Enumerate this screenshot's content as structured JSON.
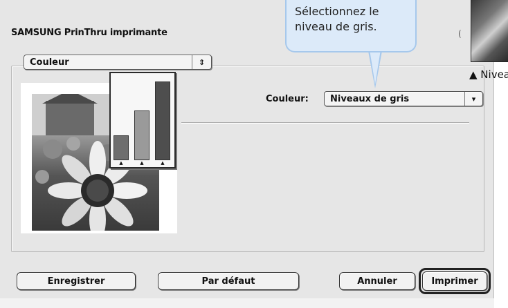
{
  "dialog": {
    "title": "SAMSUNG PrinThru imprimante",
    "title_right_mark": "("
  },
  "section_popup": {
    "value": "Couleur",
    "arrow": "⇕"
  },
  "color_setting": {
    "label": "Couleur:",
    "value": "Niveaux de gris",
    "arrow": "▾"
  },
  "preview": {
    "bars": [
      {
        "name": "low",
        "value": 0.3,
        "color": "#6e6e6e"
      },
      {
        "name": "mid",
        "value": 0.6,
        "color": "#9a9a9a"
      },
      {
        "name": "high",
        "value": 0.95,
        "color": "#4e4e4e"
      }
    ],
    "dot": "▲"
  },
  "buttons": {
    "save": "Enregistrer",
    "default": "Par défaut",
    "cancel": "Annuler",
    "print": "Imprimer"
  },
  "callout": {
    "text": "Sélectionnez le niveau de gris."
  },
  "thumbnail": {
    "caption": "▲ Niveaux de gris"
  }
}
